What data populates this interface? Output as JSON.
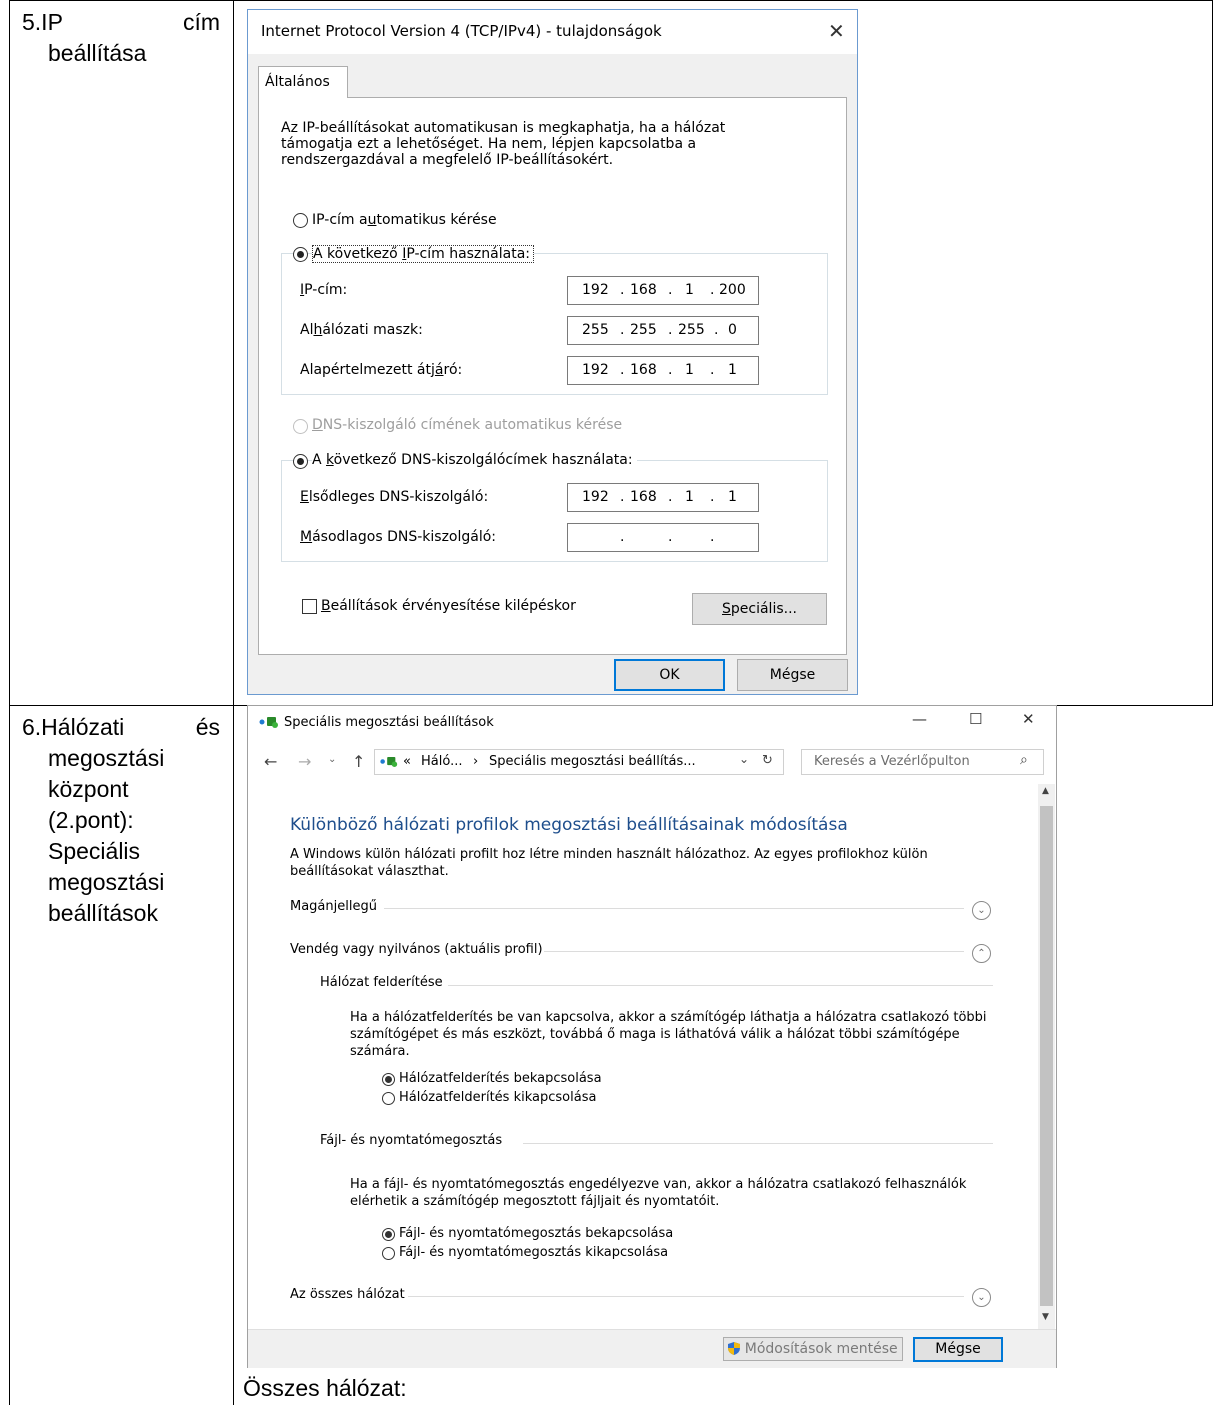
{
  "table": {
    "row5": {
      "label_line1_left": "5.IP",
      "label_line1_right": "cím",
      "label_line2": "beállítása"
    },
    "row6": {
      "label_line1_left": "6.Hálózati",
      "label_line1_right": "és",
      "label_lines": [
        "megosztási",
        "központ",
        "(2.pont):",
        "Speciális",
        "megosztási",
        "beállítások"
      ]
    },
    "caption": "Összes hálózat:"
  },
  "ipv4_dialog": {
    "title": "Internet Protocol Version 4 (TCP/IPv4) - tulajdonságok",
    "tab": "Általános",
    "intro": [
      "Az IP-beállításokat automatikusan is megkaphatja, ha a hálózat",
      "támogatja ezt a lehetőséget. Ha nem, lépjen kapcsolatba a",
      "rendszergazdával a megfelelő IP-beállításokért."
    ],
    "radio_auto_ip": {
      "pre": "IP-cím a",
      "acc": "u",
      "post": "tomatikus kérése"
    },
    "radio_manual_ip": {
      "pre": "A következő ",
      "acc": "I",
      "post": "P-cím használata:"
    },
    "ip_label": {
      "acc": "I",
      "post": "P-cím:"
    },
    "mask_label": {
      "pre": "Al",
      "acc": "h",
      "post": "álózati maszk:"
    },
    "gateway_label": {
      "pre": "Alapértelmezett átj",
      "acc": "á",
      "post": "ró:"
    },
    "ip": [
      "192",
      "168",
      "1",
      "200"
    ],
    "mask": [
      "255",
      "255",
      "255",
      "0"
    ],
    "gateway": [
      "192",
      "168",
      "1",
      "1"
    ],
    "radio_auto_dns": {
      "acc": "D",
      "post": "NS-kiszolgáló címének automatikus kérése"
    },
    "radio_manual_dns": {
      "pre": "A ",
      "acc": "k",
      "post": "övetkező DNS-kiszolgálócímek használata:"
    },
    "dns1_label": {
      "acc": "E",
      "post": "lsődleges DNS-kiszolgáló:"
    },
    "dns2_label": {
      "acc": "M",
      "post": "ásodlagos DNS-kiszolgáló:"
    },
    "dns1": [
      "192",
      "168",
      "1",
      "1"
    ],
    "dns2": [
      "",
      "",
      "",
      ""
    ],
    "validate_checkbox": {
      "acc": "B",
      "post": "eállítások érvényesítése kilépéskor"
    },
    "advanced_button": {
      "acc": "S",
      "post": "peciális..."
    },
    "ok": "OK",
    "cancel": "Mégse"
  },
  "sharing_window": {
    "title": "Speciális megosztási beállítások",
    "minimize": "—",
    "maximize": "☐",
    "close": "✕",
    "breadcrumb": [
      "«",
      "Háló...",
      "›",
      "Speciális megosztási beállítás..."
    ],
    "search_placeholder": "Keresés a Vezérlőpulton",
    "heading": "Különböző hálózati profilok megosztási beállításainak módosítása",
    "description": [
      "A Windows külön hálózati profilt hoz létre minden használt hálózathoz. Az egyes profilokhoz külön",
      "beállításokat választhat."
    ],
    "profile_private": "Magánjellegű",
    "profile_public": "Vendég vagy nyilvános (aktuális profil)",
    "discovery": {
      "title": "Hálózat felderítése",
      "text": [
        "Ha a hálózatfelderítés be van kapcsolva, akkor a számítógép láthatja a hálózatra csatlakozó többi",
        "számítógépet és más eszközt, továbbá ő maga is láthatóvá válik a hálózat többi számítógépe",
        "számára."
      ],
      "on": "Hálózatfelderítés bekapcsolása",
      "off": "Hálózatfelderítés kikapcsolása"
    },
    "filesharing": {
      "title": "Fájl- és nyomtatómegosztás",
      "text": [
        "Ha a fájl- és nyomtatómegosztás engedélyezve van, akkor a hálózatra csatlakozó felhasználók",
        "elérhetik a számítógép megosztott fájljait és nyomtatóit."
      ],
      "on": "Fájl- és nyomtatómegosztás bekapcsolása",
      "off": "Fájl- és nyomtatómegosztás kikapcsolása"
    },
    "all_networks": "Az összes hálózat",
    "save_button": "Módosítások mentése",
    "cancel_button": "Mégse"
  }
}
